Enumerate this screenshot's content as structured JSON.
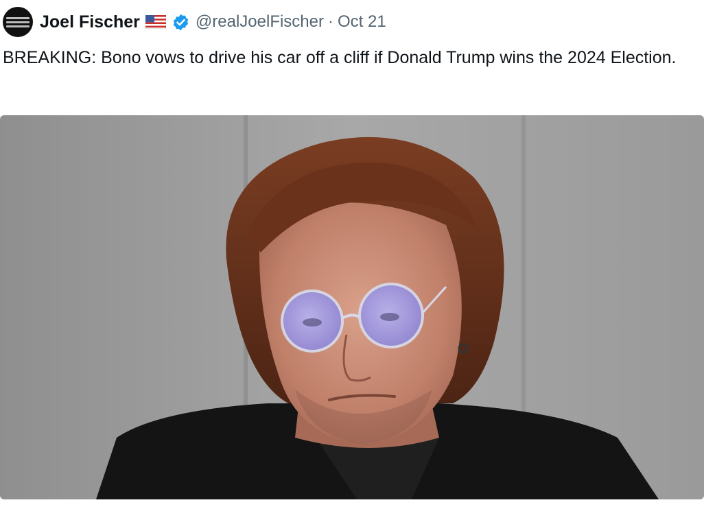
{
  "post": {
    "author": {
      "display_name": "Joel Fischer",
      "handle": "@realJoelFischer",
      "separator": "·",
      "date": "Oct 21",
      "flag_icon": "us-flag-icon",
      "verified_icon": "verified-badge-icon",
      "verified_color": "#1d9bf0"
    },
    "text": "BREAKING: Bono vows to drive his car off a cliff if Donald Trump wins the 2024 Election.",
    "media": {
      "alt": "Photo of a man with reddish-brown hair wearing round purple-tinted glasses and a black jacket against a gray background"
    }
  },
  "colors": {
    "text_primary": "#0f1419",
    "text_secondary": "#536471",
    "background": "#ffffff"
  }
}
